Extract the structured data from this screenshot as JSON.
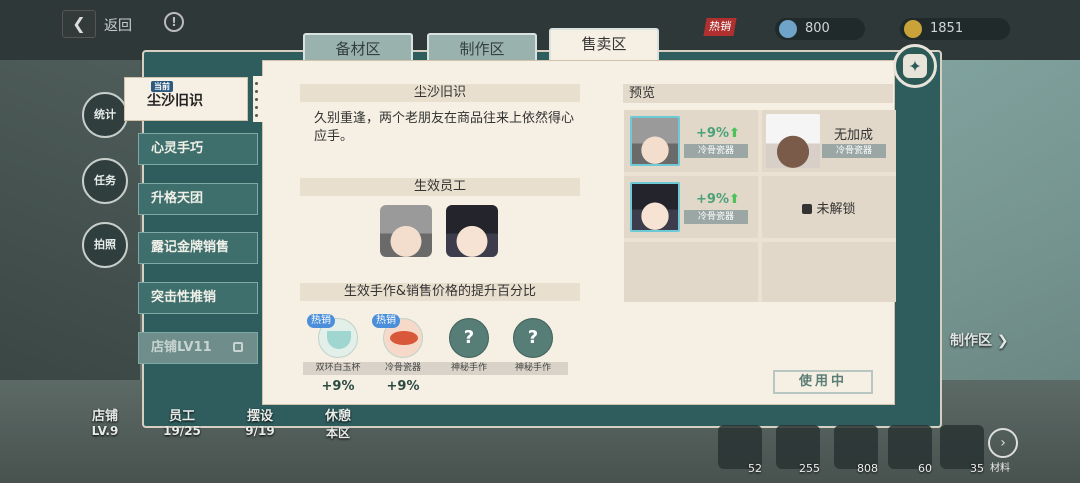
{
  "topbar": {
    "back_label": "返回",
    "hot_tag": "热销",
    "resource_a_value": "800",
    "resource_b_value": "1851"
  },
  "tabs": [
    {
      "label": "备材区",
      "active": false
    },
    {
      "label": "制作区",
      "active": false
    },
    {
      "label": "售卖区",
      "active": true
    }
  ],
  "sidebar": {
    "active_badge": "当前",
    "items": [
      {
        "label": "尘沙旧识"
      },
      {
        "label": "心灵手巧"
      },
      {
        "label": "升格天团"
      },
      {
        "label": "露记金牌销售"
      },
      {
        "label": "突击性推销"
      },
      {
        "label": "店铺LV11"
      }
    ]
  },
  "float_buttons": [
    "统计",
    "任务",
    "拍照"
  ],
  "detail": {
    "title": "尘沙旧识",
    "description": "久别重逢，两个老朋友在商品往来上依然得心应手。",
    "staff_header": "生效员工",
    "craft_header": "生效手作&销售价格的提升百分比",
    "crafts": [
      {
        "name": "双环白玉杯",
        "hot": "热销",
        "pct": "+9%",
        "kind": "teacup"
      },
      {
        "name": "冷骨瓷器",
        "hot": "热销",
        "pct": "+9%",
        "kind": "porcelain"
      },
      {
        "name": "神秘手作",
        "hot": "",
        "pct": "",
        "kind": "unknown",
        "mark": "?"
      },
      {
        "name": "神秘手作",
        "hot": "",
        "pct": "",
        "kind": "unknown",
        "mark": "?"
      }
    ]
  },
  "preview": {
    "header": "预览",
    "rows": [
      {
        "boost": "+9%",
        "tag": "冷骨瓷器",
        "right_text": "无加成",
        "right_tag": "冷骨瓷器"
      },
      {
        "boost": "+9%",
        "tag": "冷骨瓷器",
        "right_text": "未解锁"
      }
    ],
    "in_use_label": "使用中"
  },
  "bottom": {
    "stats": [
      {
        "label": "店铺",
        "value": "LV.9"
      },
      {
        "label": "员工",
        "value": "19/25"
      },
      {
        "label": "摆设",
        "value": "9/19"
      },
      {
        "label": "休憩",
        "value": "本区"
      }
    ],
    "items": [
      "52",
      "255",
      "808",
      "60",
      "35"
    ],
    "make_zone_label": "制作区",
    "materials_label": "材料"
  },
  "colors": {
    "panel_teal": "#2f5d5d",
    "paper": "#f6efe3",
    "boost_green": "#4ba17a"
  }
}
